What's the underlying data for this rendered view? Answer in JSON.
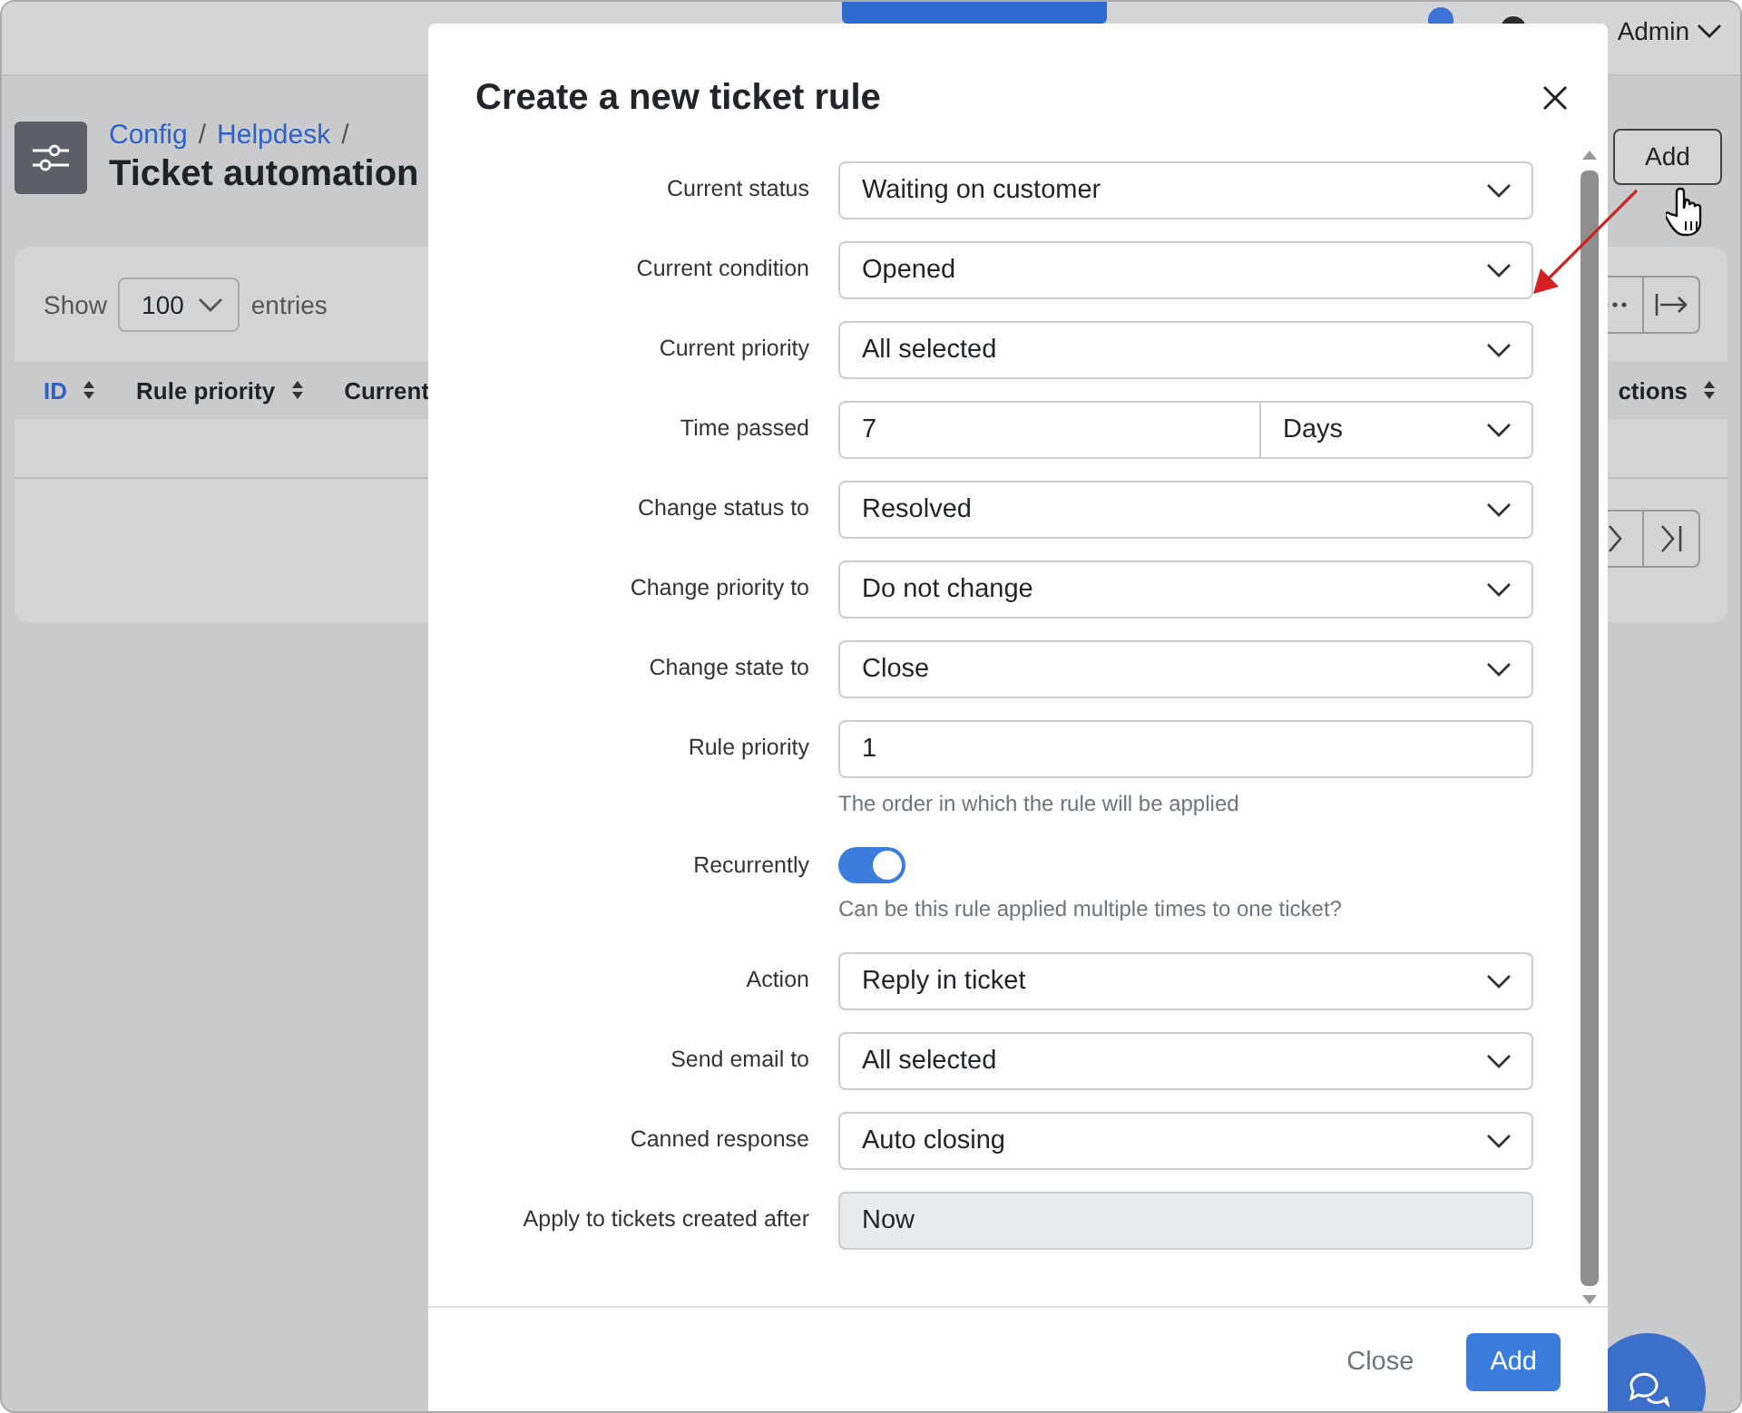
{
  "topbar": {
    "user": "Admin"
  },
  "page": {
    "breadcrumb": [
      {
        "label": "Config"
      },
      {
        "label": "Helpdesk"
      }
    ],
    "breadcrumb_separator": "/",
    "title": "Ticket automation",
    "add_button": "Add"
  },
  "table": {
    "show_label": "Show",
    "page_size": "100",
    "entries_label": "entries",
    "columns": [
      {
        "label": "ID",
        "selected": true,
        "sort_icon": true
      },
      {
        "label": "Rule priority",
        "selected": false,
        "sort_icon": true
      },
      {
        "label": "Current",
        "selected": false,
        "sort_icon": false
      },
      {
        "label": "ctions",
        "selected": false,
        "sort_icon": true
      }
    ]
  },
  "modal": {
    "title": "Create a new ticket rule",
    "rows": [
      {
        "kind": "select",
        "label": "Current status",
        "value": "Waiting on customer"
      },
      {
        "kind": "select",
        "label": "Current condition",
        "value": "Opened"
      },
      {
        "kind": "select",
        "label": "Current priority",
        "value": "All selected"
      },
      {
        "kind": "split",
        "label": "Time passed",
        "value": "7",
        "unit": "Days"
      },
      {
        "kind": "select",
        "label": "Change status to",
        "value": "Resolved"
      },
      {
        "kind": "select",
        "label": "Change priority to",
        "value": "Do not change"
      },
      {
        "kind": "select",
        "label": "Change state to",
        "value": "Close"
      },
      {
        "kind": "input",
        "label": "Rule priority",
        "value": "1",
        "help": "The order in which the rule will be applied"
      },
      {
        "kind": "toggle",
        "label": "Recurrently",
        "on": true,
        "help": "Can be this rule applied multiple times to one ticket?"
      },
      {
        "kind": "select",
        "label": "Action",
        "value": "Reply in ticket"
      },
      {
        "kind": "select",
        "label": "Send email to",
        "value": "All selected"
      },
      {
        "kind": "select",
        "label": "Canned response",
        "value": "Auto closing"
      },
      {
        "kind": "readonly",
        "label": "Apply to tickets created after",
        "value": "Now"
      }
    ],
    "buttons": [
      {
        "kind": "link",
        "label": "Close"
      },
      {
        "kind": "primary",
        "label": "Add"
      }
    ]
  }
}
